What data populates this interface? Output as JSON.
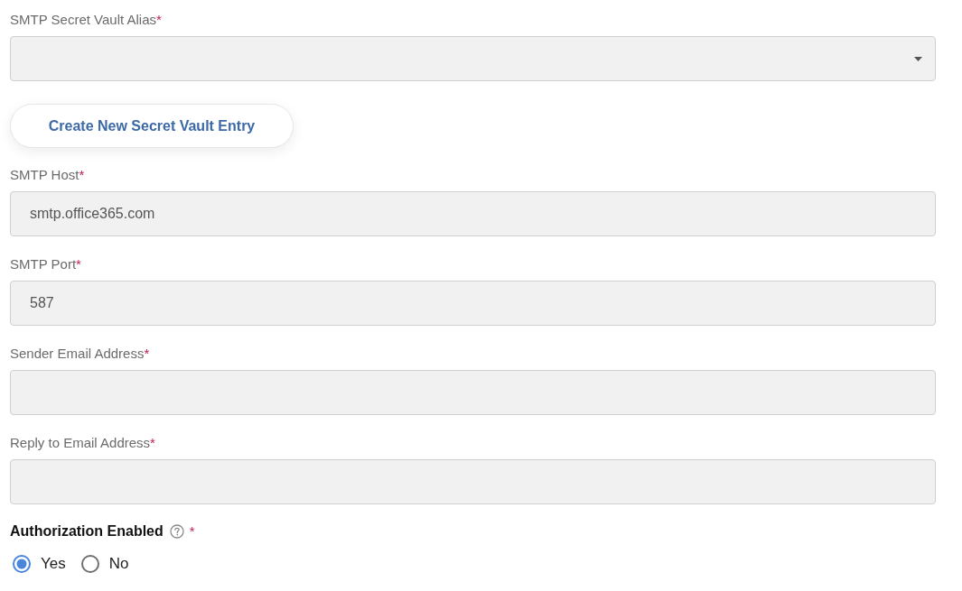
{
  "vault_alias": {
    "label": "SMTP Secret Vault Alias",
    "required_mark": "*"
  },
  "create_button": {
    "label": "Create New Secret Vault Entry"
  },
  "fields": [
    {
      "label": "SMTP Host",
      "required_mark": "*",
      "value": "smtp.office365.com"
    },
    {
      "label": "SMTP Port",
      "required_mark": "*",
      "value": "587"
    },
    {
      "label": "Sender Email Address",
      "required_mark": "*"
    },
    {
      "label": "Reply to Email Address",
      "required_mark": "*"
    }
  ],
  "authorization": {
    "label": "Authorization Enabled",
    "required_mark": "*",
    "options": [
      {
        "label": "Yes",
        "selected": true
      },
      {
        "label": "No",
        "selected": false
      }
    ]
  }
}
